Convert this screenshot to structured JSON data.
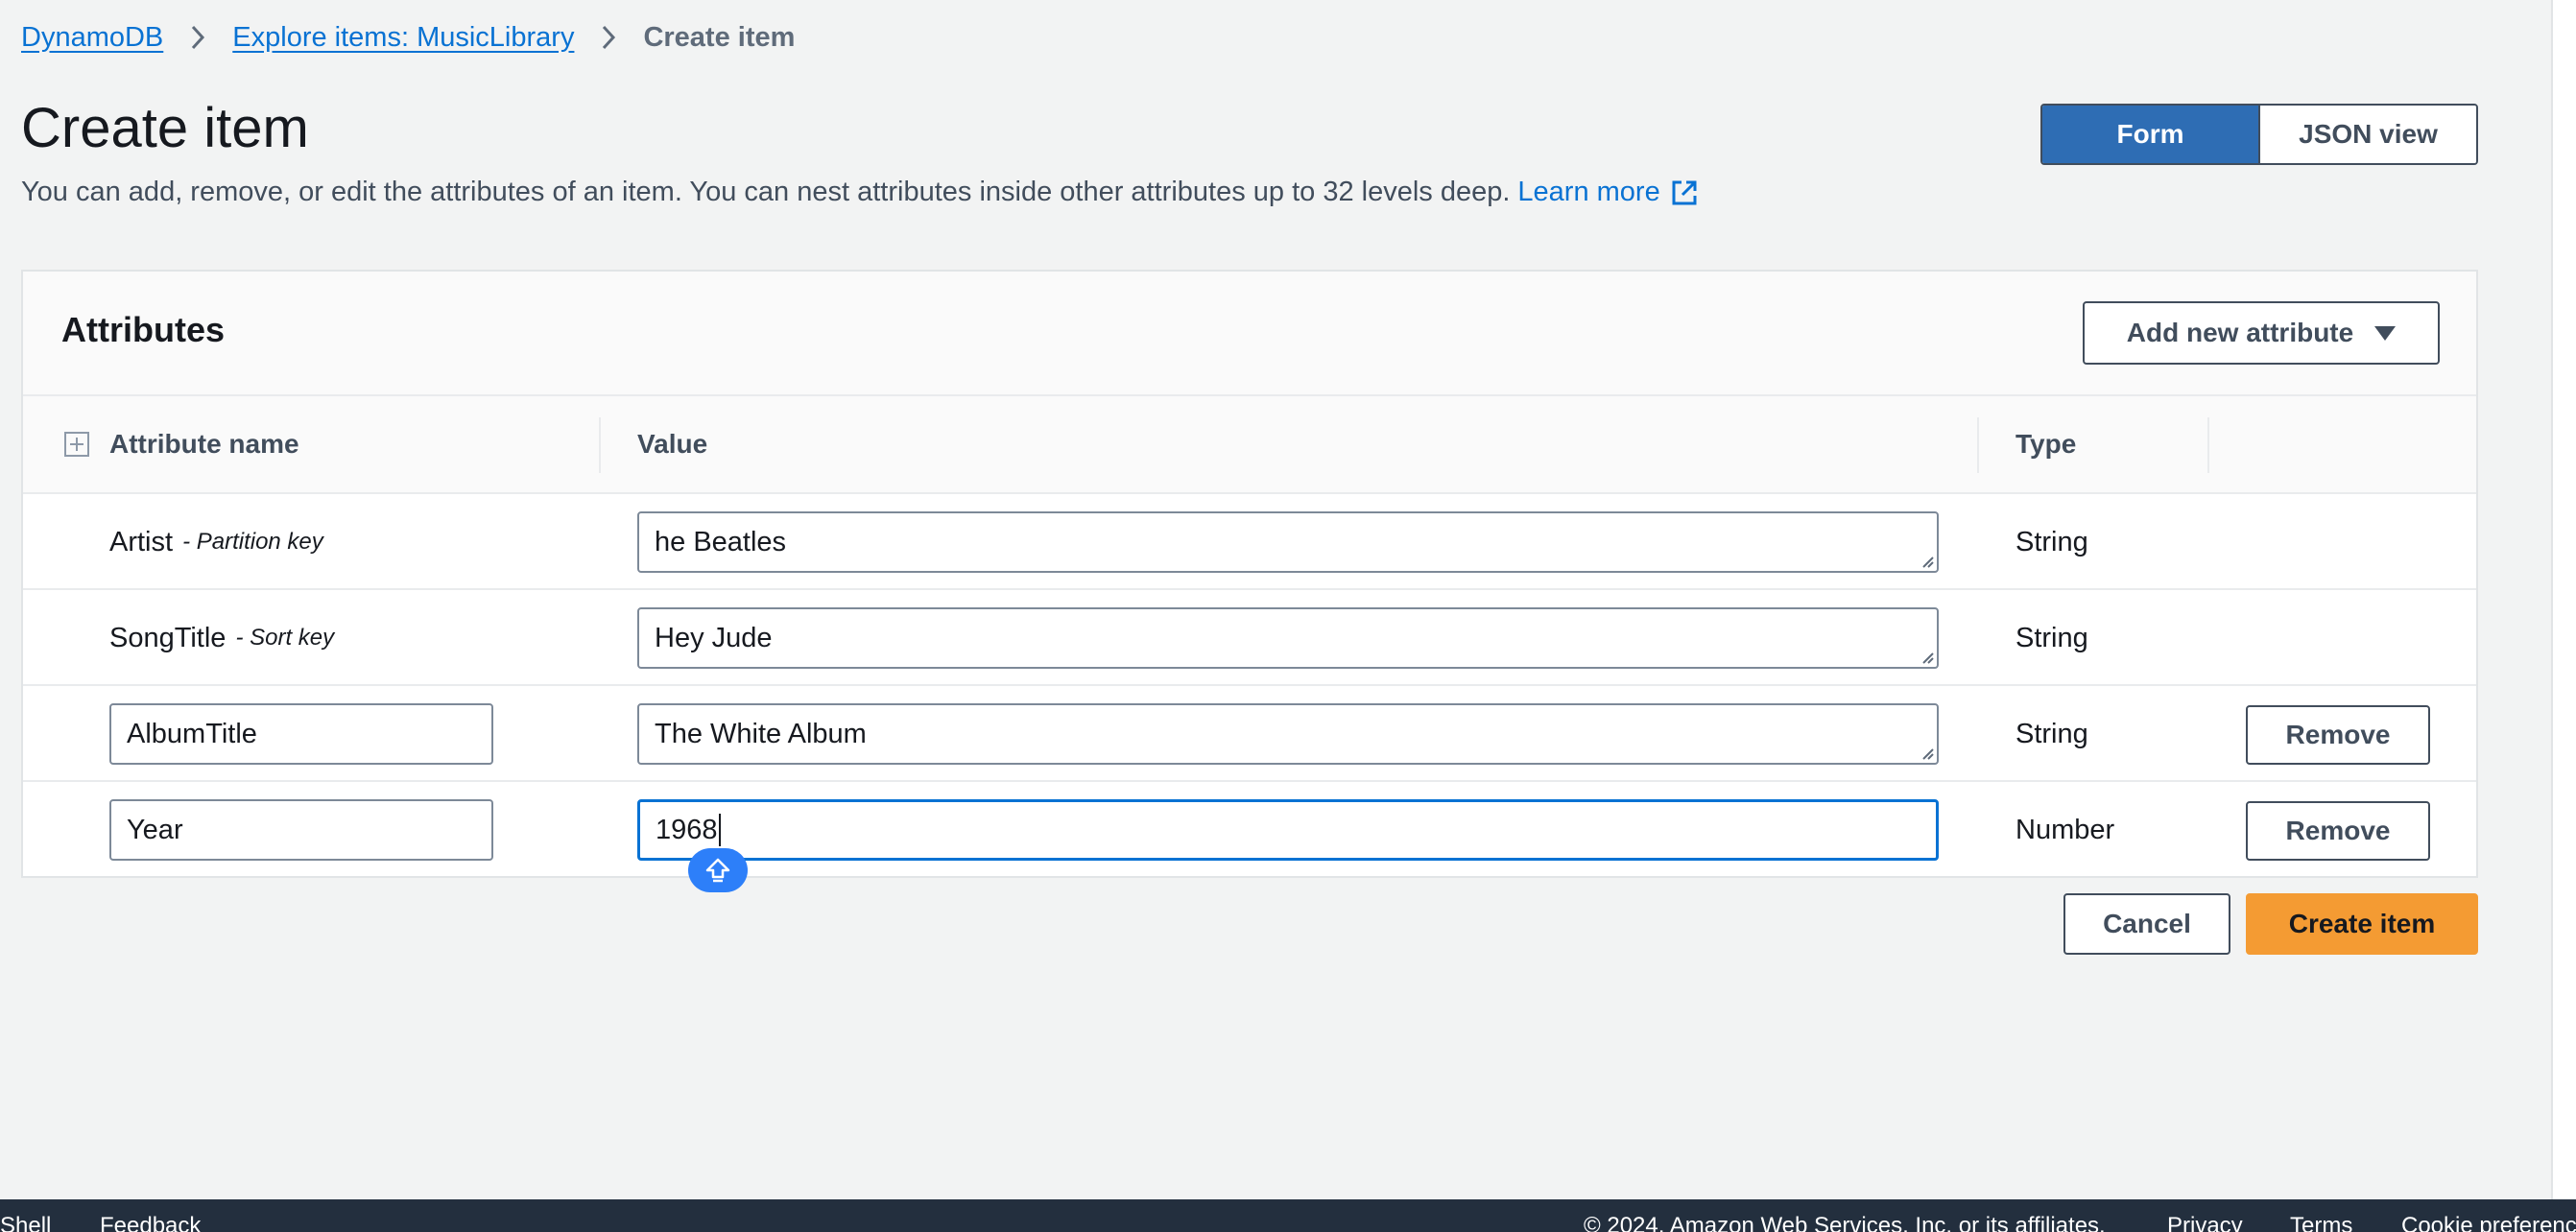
{
  "breadcrumb": {
    "items": [
      "DynamoDB",
      "Explore items: MusicLibrary"
    ],
    "current": "Create item"
  },
  "header": {
    "title": "Create item",
    "description": "You can add, remove, or edit the attributes of an item. You can nest attributes inside other attributes up to 32 levels deep.",
    "learn_more": "Learn more"
  },
  "view_toggle": {
    "form": "Form",
    "json": "JSON view",
    "selected": "Form"
  },
  "attributes": {
    "title": "Attributes",
    "add_button": "Add new attribute",
    "columns": {
      "name": "Attribute name",
      "value": "Value",
      "type": "Type"
    },
    "rows": [
      {
        "name": "Artist",
        "key_hint": "- Partition key",
        "value": "he Beatles",
        "type": "String"
      },
      {
        "name": "SongTitle",
        "key_hint": "- Sort key",
        "value": "Hey Jude",
        "type": "String"
      },
      {
        "name": "AlbumTitle",
        "value": "The White Album",
        "type": "String",
        "remove": "Remove"
      },
      {
        "name": "Year",
        "value": "1968",
        "type": "Number",
        "remove": "Remove"
      }
    ]
  },
  "actions": {
    "cancel": "Cancel",
    "create": "Create item"
  },
  "footer": {
    "left": [
      "Shell",
      "Feedback"
    ],
    "copyright": "© 2024, Amazon Web Services, Inc. or its affiliates.",
    "right": [
      "Privacy",
      "Terms",
      "Cookie preferences"
    ]
  },
  "colors": {
    "primary": "#2e6db4",
    "link": "#0972d3",
    "create": "#f49b33",
    "footer": "#232f3e"
  }
}
